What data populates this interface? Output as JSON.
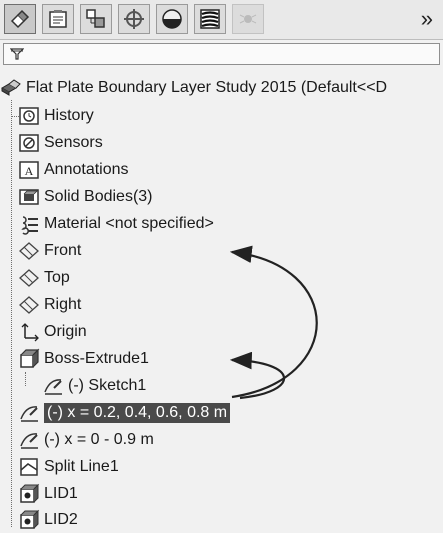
{
  "toolbar": {
    "buttons": [
      {
        "icon": "feature-manager-tree-icon",
        "active": true
      },
      {
        "icon": "property-manager-icon",
        "active": false
      },
      {
        "icon": "configuration-manager-icon",
        "active": false
      },
      {
        "icon": "dimxpert-manager-icon",
        "active": false
      },
      {
        "icon": "display-manager-icon",
        "active": false
      },
      {
        "icon": "flow-simulation-icon",
        "active": false
      },
      {
        "icon": "extra-tab-icon",
        "active": false
      }
    ],
    "more_label": "»"
  },
  "filter": {
    "icon": "filter-icon"
  },
  "tree": {
    "root": {
      "label": "Flat Plate Boundary Layer Study 2015  (Default<<D",
      "icon": "part-icon"
    },
    "items": [
      {
        "label": "History",
        "icon": "history-icon"
      },
      {
        "label": "Sensors",
        "icon": "sensors-icon"
      },
      {
        "label": "Annotations",
        "icon": "annotations-icon"
      },
      {
        "label": "Solid Bodies(3)",
        "icon": "solid-bodies-icon"
      },
      {
        "label": "Material <not specified>",
        "icon": "material-icon"
      },
      {
        "label": "Front",
        "icon": "plane-icon"
      },
      {
        "label": "Top",
        "icon": "plane-icon"
      },
      {
        "label": "Right",
        "icon": "plane-icon"
      },
      {
        "label": "Origin",
        "icon": "origin-icon"
      },
      {
        "label": "Boss-Extrude1",
        "icon": "extrude-icon"
      },
      {
        "label": "(-) Sketch1",
        "icon": "sketch-icon"
      },
      {
        "label": "(-) x = 0.2, 0.4, 0.6, 0.8 m",
        "icon": "sketch-icon",
        "selected": true
      },
      {
        "label": "(-) x = 0 - 0.9 m",
        "icon": "sketch-icon"
      },
      {
        "label": "Split Line1",
        "icon": "split-line-icon"
      },
      {
        "label": "LID1",
        "icon": "lid-icon"
      },
      {
        "label": "LID2",
        "icon": "lid-icon"
      }
    ]
  }
}
